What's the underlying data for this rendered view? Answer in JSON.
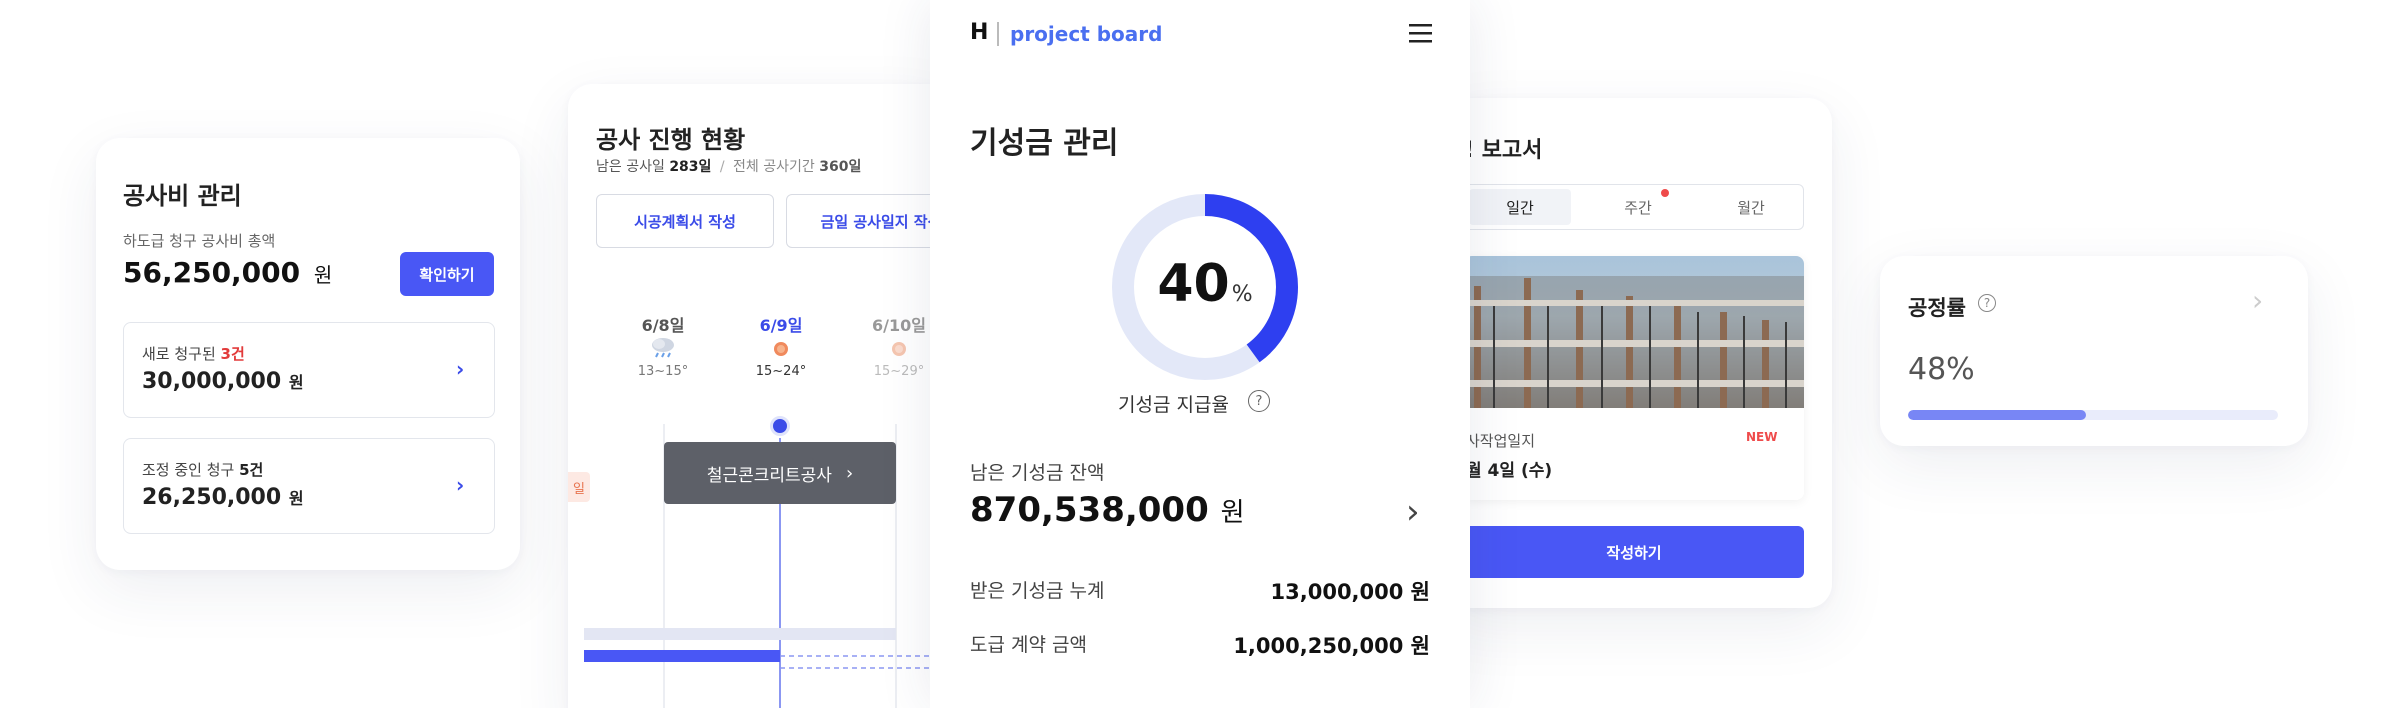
{
  "cost_card": {
    "title": "공사비 관리",
    "total_label": "하도급 청구 공사비 총액",
    "total_amount": "56,250,000",
    "won": "원",
    "confirm_button": "확인하기",
    "new_claims": {
      "label": "새로 청구된 ",
      "count": "3건",
      "amount": "30,000,000",
      "unit": "원"
    },
    "adjust_claims": {
      "label": "조정 중인 청구 ",
      "count": "5건",
      "amount": "26,250,000",
      "unit": "원"
    }
  },
  "progress_card": {
    "title": "공사 진행 현황",
    "remaining_label": "남은 공사일",
    "remaining_days": "283일",
    "separator": "/",
    "total_label": "전체 공사기간",
    "total_days": "360일",
    "plan_button": "시공계획서 작성",
    "daily_log_button": "금일 공사일지 작성",
    "days": [
      {
        "date": "6/8일",
        "temp": "13~15°",
        "weather": "cloud-rain"
      },
      {
        "date": "6/9일",
        "temp": "15~24°",
        "weather": "sunny"
      },
      {
        "date": "6/10일",
        "temp": "15~29°",
        "weather": "sunny"
      }
    ],
    "tooltip_label": "철근콘크리트공사",
    "left_tag": "일"
  },
  "phone": {
    "brand_letter": "H",
    "brand_name": "project board",
    "title": "기성금 관리",
    "percent_value": "40",
    "percent_sign": "%",
    "rate_label": "기성금 지급율",
    "remaining_label": "남은 기성금 잔액",
    "remaining_amount": "870,538,000",
    "won": "원",
    "received_label": "받은 기성금 누계",
    "received_amount": "13,000,000 원",
    "contract_label": "도급 계약 금액",
    "contract_amount": "1,000,250,000 원",
    "progress_fraction": 0.4,
    "accent": "#2e3ff0",
    "track": "#e3e8f8"
  },
  "report_card": {
    "title": "! 보고서",
    "tabs": [
      "일간",
      "주간",
      "월간"
    ],
    "item_line1": "사작업일지",
    "item_line2": "월 4일 (수)",
    "new_badge": "NEW",
    "write_button": "작성하기"
  },
  "rate_card": {
    "title": "공정률",
    "value": "48%",
    "fraction": 0.48
  }
}
